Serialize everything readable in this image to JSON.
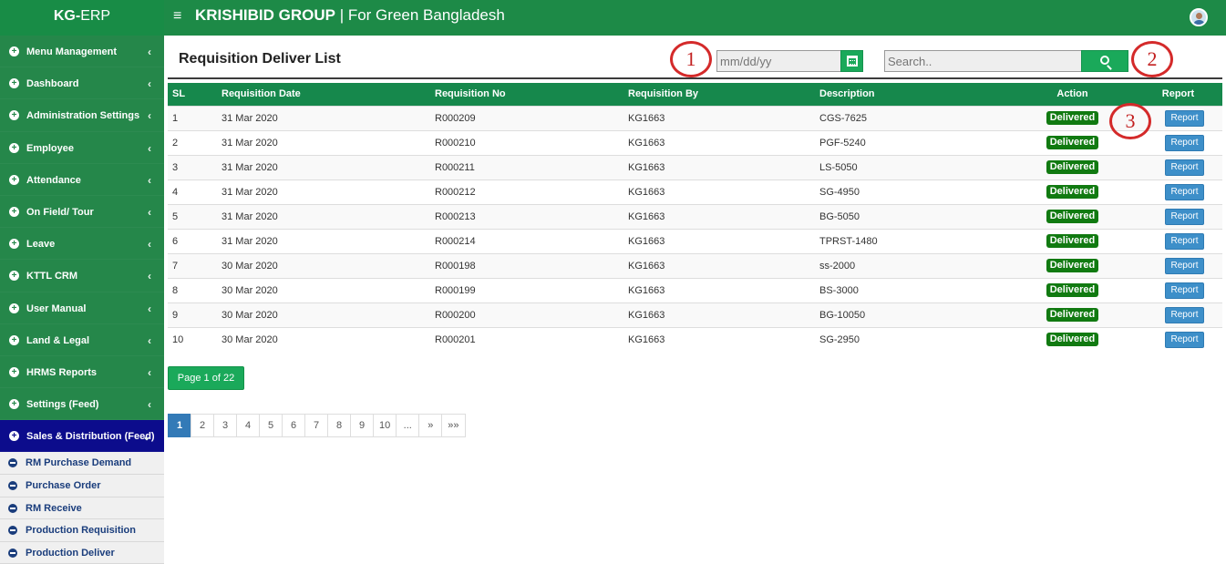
{
  "app": {
    "brand_bold": "KG-",
    "brand_rest": "ERP",
    "hamburger": "≡",
    "company_bold": "KRISHIBID GROUP",
    "company_rest": " | For Green Bangladesh"
  },
  "sidebar": {
    "items": [
      {
        "label": "Menu Management"
      },
      {
        "label": "Dashboard"
      },
      {
        "label": "Administration Settings"
      },
      {
        "label": "Employee"
      },
      {
        "label": "Attendance"
      },
      {
        "label": "On Field/ Tour"
      },
      {
        "label": "Leave"
      },
      {
        "label": "KTTL CRM"
      },
      {
        "label": "User Manual"
      },
      {
        "label": "Land & Legal"
      },
      {
        "label": "HRMS Reports"
      },
      {
        "label": "Settings (Feed)"
      },
      {
        "label": "Sales & Distribution (Feed)"
      }
    ],
    "sub_items": [
      {
        "label": "RM Purchase Demand"
      },
      {
        "label": "Purchase Order"
      },
      {
        "label": "RM Receive"
      },
      {
        "label": "Production Requisition"
      },
      {
        "label": "Production Deliver"
      }
    ],
    "expand_glyph": "+",
    "chevron": "‹",
    "active_chevron": "⌄"
  },
  "main": {
    "title": "Requisition Deliver List",
    "date_placeholder": "mm/dd/yy",
    "search_placeholder": "Search..",
    "annotations": [
      "1",
      "2",
      "3"
    ]
  },
  "table": {
    "headers": [
      "SL",
      "Requisition Date",
      "Requisition No",
      "Requisition By",
      "Description",
      "Action",
      "Report"
    ],
    "action_label": "Delivered",
    "report_label": "Report",
    "rows": [
      {
        "sl": "1",
        "date": "31 Mar 2020",
        "no": "R000209",
        "by": "KG1663",
        "desc": "CGS-7625"
      },
      {
        "sl": "2",
        "date": "31 Mar 2020",
        "no": "R000210",
        "by": "KG1663",
        "desc": "PGF-5240"
      },
      {
        "sl": "3",
        "date": "31 Mar 2020",
        "no": "R000211",
        "by": "KG1663",
        "desc": "LS-5050"
      },
      {
        "sl": "4",
        "date": "31 Mar 2020",
        "no": "R000212",
        "by": "KG1663",
        "desc": "SG-4950"
      },
      {
        "sl": "5",
        "date": "31 Mar 2020",
        "no": "R000213",
        "by": "KG1663",
        "desc": "BG-5050"
      },
      {
        "sl": "6",
        "date": "31 Mar 2020",
        "no": "R000214",
        "by": "KG1663",
        "desc": "TPRST-1480"
      },
      {
        "sl": "7",
        "date": "30 Mar 2020",
        "no": "R000198",
        "by": "KG1663",
        "desc": "ss-2000"
      },
      {
        "sl": "8",
        "date": "30 Mar 2020",
        "no": "R000199",
        "by": "KG1663",
        "desc": "BS-3000"
      },
      {
        "sl": "9",
        "date": "30 Mar 2020",
        "no": "R000200",
        "by": "KG1663",
        "desc": "BG-10050"
      },
      {
        "sl": "10",
        "date": "30 Mar 2020",
        "no": "R000201",
        "by": "KG1663",
        "desc": "SG-2950"
      }
    ]
  },
  "pagination": {
    "info": "Page 1 of 22",
    "pages": [
      "1",
      "2",
      "3",
      "4",
      "5",
      "6",
      "7",
      "8",
      "9",
      "10",
      "...",
      "»",
      "»»"
    ],
    "current": "1"
  },
  "colors": {
    "brand_green": "#1d8a47",
    "sidebar_green": "#25874a",
    "active_blue": "#0c0c8c",
    "delivered_green": "#117a11",
    "report_blue": "#3d8fc9",
    "annotation_red": "#d42a2a"
  }
}
